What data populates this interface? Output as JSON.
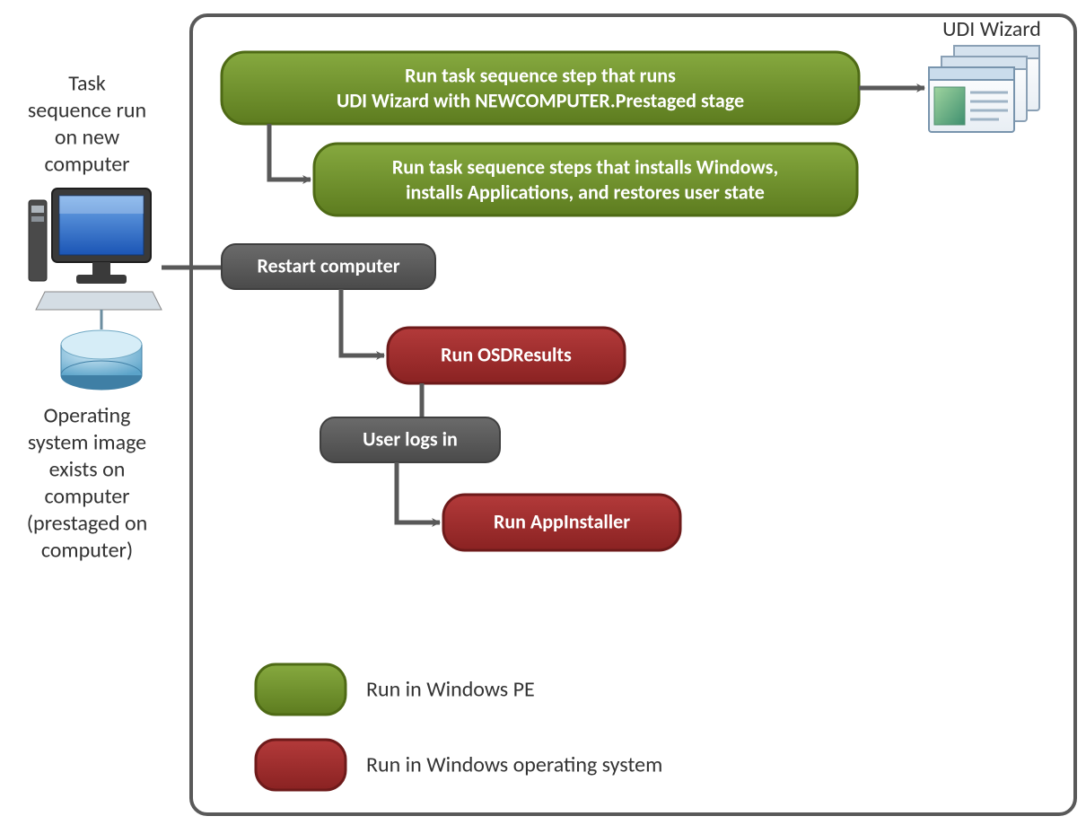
{
  "labels": {
    "udi_wizard": "UDI Wizard",
    "task_sequence_l1": "Task",
    "task_sequence_l2": "sequence run",
    "task_sequence_l3": "on new",
    "task_sequence_l4": "computer",
    "os_image_l1": "Operating",
    "os_image_l2": "system image",
    "os_image_l3": "exists on",
    "os_image_l4": "computer",
    "os_image_l5": "(prestaged on",
    "os_image_l6": "computer)"
  },
  "nodes": {
    "step1_l1": "Run task sequence step  that runs",
    "step1_l2": "UDI Wizard with NEWCOMPUTER.Prestaged  stage",
    "step2_l1": "Run task sequence steps that installs Windows,",
    "step2_l2": "installs Applications, and restores user state",
    "step3": "Restart computer",
    "step4": "Run OSDResults",
    "step5": "User logs in",
    "step6": "Run AppInstaller"
  },
  "legend": {
    "pe": "Run in Windows  PE",
    "os": "Run in Windows operating system"
  },
  "colors": {
    "green_fill": "#6b8e23",
    "green_stroke": "#4e6a15",
    "red_fill": "#9e2b2b",
    "red_stroke": "#6e1a1a",
    "grey_fill": "#595959",
    "grey_stroke": "#3f3f3f",
    "frame": "#595959",
    "connector": "#595959"
  }
}
